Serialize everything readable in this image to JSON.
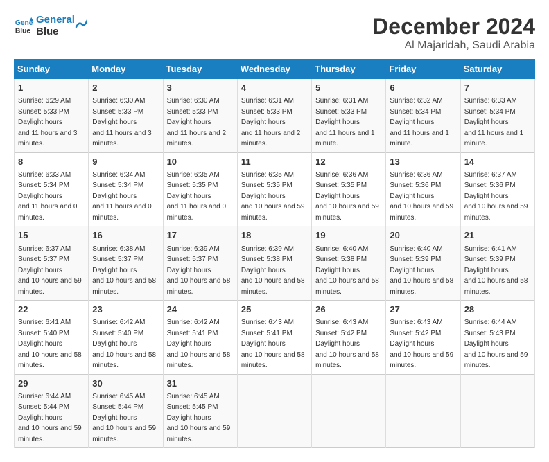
{
  "header": {
    "logo_line1": "General",
    "logo_line2": "Blue",
    "month": "December 2024",
    "location": "Al Majaridah, Saudi Arabia"
  },
  "weekdays": [
    "Sunday",
    "Monday",
    "Tuesday",
    "Wednesday",
    "Thursday",
    "Friday",
    "Saturday"
  ],
  "weeks": [
    [
      {
        "day": "1",
        "sunrise": "6:29 AM",
        "sunset": "5:33 PM",
        "daylight": "11 hours and 3 minutes."
      },
      {
        "day": "2",
        "sunrise": "6:30 AM",
        "sunset": "5:33 PM",
        "daylight": "11 hours and 3 minutes."
      },
      {
        "day": "3",
        "sunrise": "6:30 AM",
        "sunset": "5:33 PM",
        "daylight": "11 hours and 2 minutes."
      },
      {
        "day": "4",
        "sunrise": "6:31 AM",
        "sunset": "5:33 PM",
        "daylight": "11 hours and 2 minutes."
      },
      {
        "day": "5",
        "sunrise": "6:31 AM",
        "sunset": "5:33 PM",
        "daylight": "11 hours and 1 minute."
      },
      {
        "day": "6",
        "sunrise": "6:32 AM",
        "sunset": "5:34 PM",
        "daylight": "11 hours and 1 minute."
      },
      {
        "day": "7",
        "sunrise": "6:33 AM",
        "sunset": "5:34 PM",
        "daylight": "11 hours and 1 minute."
      }
    ],
    [
      {
        "day": "8",
        "sunrise": "6:33 AM",
        "sunset": "5:34 PM",
        "daylight": "11 hours and 0 minutes."
      },
      {
        "day": "9",
        "sunrise": "6:34 AM",
        "sunset": "5:34 PM",
        "daylight": "11 hours and 0 minutes."
      },
      {
        "day": "10",
        "sunrise": "6:35 AM",
        "sunset": "5:35 PM",
        "daylight": "11 hours and 0 minutes."
      },
      {
        "day": "11",
        "sunrise": "6:35 AM",
        "sunset": "5:35 PM",
        "daylight": "10 hours and 59 minutes."
      },
      {
        "day": "12",
        "sunrise": "6:36 AM",
        "sunset": "5:35 PM",
        "daylight": "10 hours and 59 minutes."
      },
      {
        "day": "13",
        "sunrise": "6:36 AM",
        "sunset": "5:36 PM",
        "daylight": "10 hours and 59 minutes."
      },
      {
        "day": "14",
        "sunrise": "6:37 AM",
        "sunset": "5:36 PM",
        "daylight": "10 hours and 59 minutes."
      }
    ],
    [
      {
        "day": "15",
        "sunrise": "6:37 AM",
        "sunset": "5:37 PM",
        "daylight": "10 hours and 59 minutes."
      },
      {
        "day": "16",
        "sunrise": "6:38 AM",
        "sunset": "5:37 PM",
        "daylight": "10 hours and 58 minutes."
      },
      {
        "day": "17",
        "sunrise": "6:39 AM",
        "sunset": "5:37 PM",
        "daylight": "10 hours and 58 minutes."
      },
      {
        "day": "18",
        "sunrise": "6:39 AM",
        "sunset": "5:38 PM",
        "daylight": "10 hours and 58 minutes."
      },
      {
        "day": "19",
        "sunrise": "6:40 AM",
        "sunset": "5:38 PM",
        "daylight": "10 hours and 58 minutes."
      },
      {
        "day": "20",
        "sunrise": "6:40 AM",
        "sunset": "5:39 PM",
        "daylight": "10 hours and 58 minutes."
      },
      {
        "day": "21",
        "sunrise": "6:41 AM",
        "sunset": "5:39 PM",
        "daylight": "10 hours and 58 minutes."
      }
    ],
    [
      {
        "day": "22",
        "sunrise": "6:41 AM",
        "sunset": "5:40 PM",
        "daylight": "10 hours and 58 minutes."
      },
      {
        "day": "23",
        "sunrise": "6:42 AM",
        "sunset": "5:40 PM",
        "daylight": "10 hours and 58 minutes."
      },
      {
        "day": "24",
        "sunrise": "6:42 AM",
        "sunset": "5:41 PM",
        "daylight": "10 hours and 58 minutes."
      },
      {
        "day": "25",
        "sunrise": "6:43 AM",
        "sunset": "5:41 PM",
        "daylight": "10 hours and 58 minutes."
      },
      {
        "day": "26",
        "sunrise": "6:43 AM",
        "sunset": "5:42 PM",
        "daylight": "10 hours and 58 minutes."
      },
      {
        "day": "27",
        "sunrise": "6:43 AM",
        "sunset": "5:42 PM",
        "daylight": "10 hours and 59 minutes."
      },
      {
        "day": "28",
        "sunrise": "6:44 AM",
        "sunset": "5:43 PM",
        "daylight": "10 hours and 59 minutes."
      }
    ],
    [
      {
        "day": "29",
        "sunrise": "6:44 AM",
        "sunset": "5:44 PM",
        "daylight": "10 hours and 59 minutes."
      },
      {
        "day": "30",
        "sunrise": "6:45 AM",
        "sunset": "5:44 PM",
        "daylight": "10 hours and 59 minutes."
      },
      {
        "day": "31",
        "sunrise": "6:45 AM",
        "sunset": "5:45 PM",
        "daylight": "10 hours and 59 minutes."
      },
      null,
      null,
      null,
      null
    ]
  ]
}
